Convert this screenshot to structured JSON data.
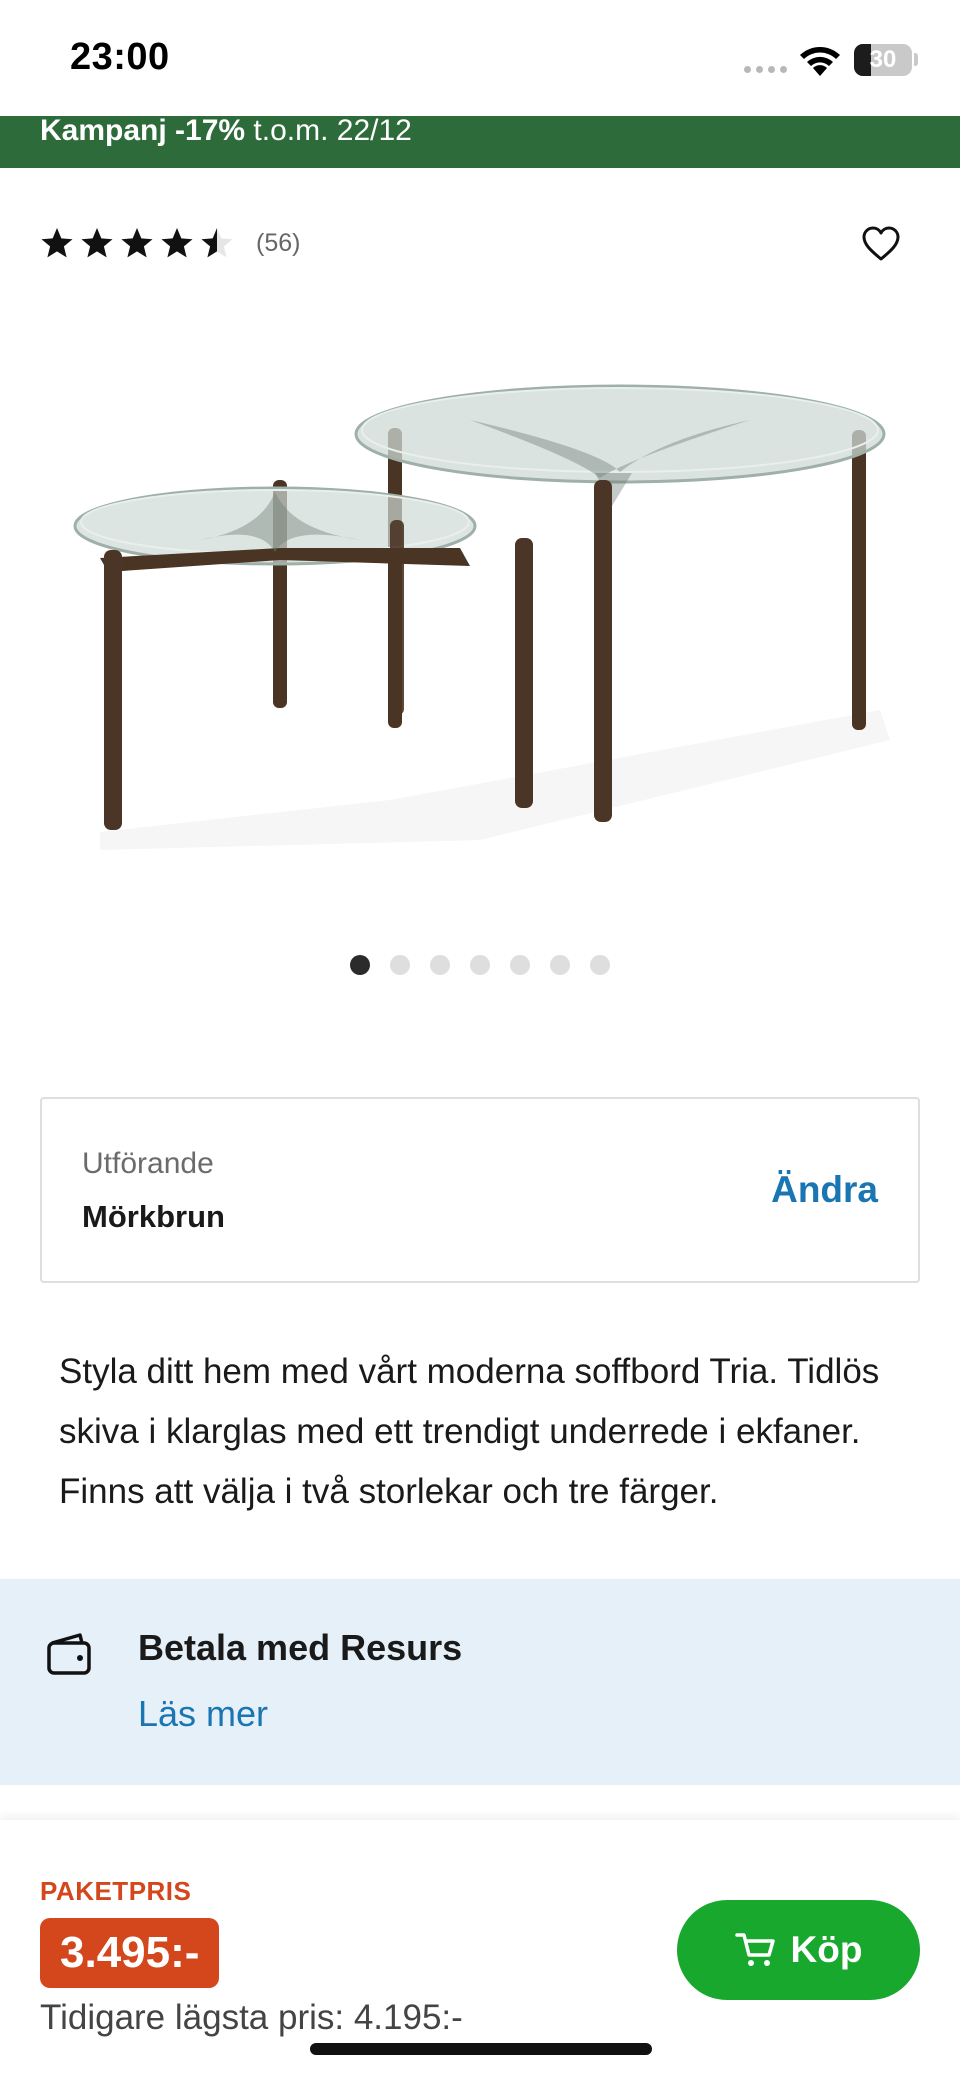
{
  "status_bar": {
    "time": "23:00",
    "battery_level": "30",
    "battery_fraction": 0.3
  },
  "banner": {
    "strong_text": "Kampanj -17%",
    "text": " t.o.m. 22/12",
    "color": "#2e6b3b"
  },
  "rating": {
    "stars": 4.5,
    "max_stars": 5,
    "count": "(56)"
  },
  "icons": {
    "wishlist": "heart-outline-icon",
    "payment": "wallet-icon",
    "buy": "cart-icon"
  },
  "carousel": {
    "total": 7,
    "active_index": 0
  },
  "variant": {
    "label": "Utförande",
    "value": "Mörkbrun",
    "change_label": "Ändra"
  },
  "description": "Styla ditt hem med vårt moderna soffbord Tria. Tidlös skiva i klarglas med ett trendigt underrede i ekfaner. Finns att välja i två storlekar och tre färger.",
  "payment": {
    "title": "Betala med Resurs",
    "link": "Läs mer"
  },
  "bottom_bar": {
    "price_label": "PAKETPRIS",
    "price": "3.495:-",
    "previous_price": "Tidigare lägsta pris: 4.195:-",
    "buy_label": "Köp",
    "price_color": "#d4461b",
    "buy_color": "#18a82e"
  }
}
